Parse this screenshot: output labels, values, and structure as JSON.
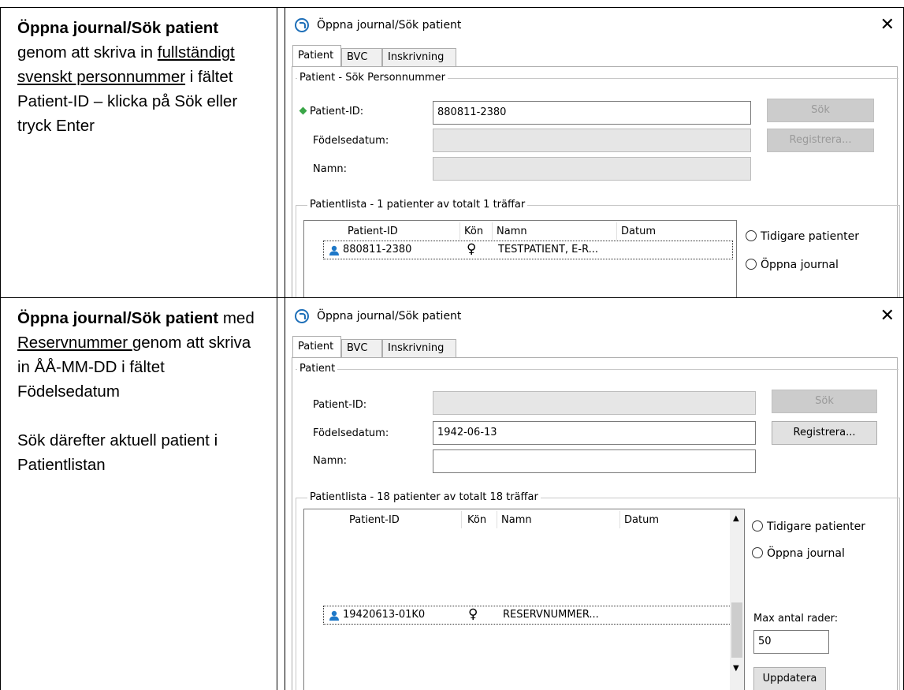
{
  "rows": [
    {
      "instruction": {
        "bold_lead": "Öppna journal/Sök patient",
        "after_bold": " genom att skriva in ",
        "underlined": "fullständigt svenskt personnummer",
        "after_underlined": " i fältet Patient-ID – klicka på Sök eller tryck Enter"
      },
      "dialog": {
        "title": "Öppna journal/Sök patient",
        "close": "✕",
        "tabs": [
          "Patient",
          "BVC",
          "Inskrivning"
        ],
        "search_group_label": "Patient - Sök Personnummer",
        "patient_id_label": "Patient-ID:",
        "patient_id_value": "880811-2380",
        "birthdate_label": "Födelsedatum:",
        "birthdate_value": "",
        "name_label": "Namn:",
        "name_value": "",
        "search_button": "Sök",
        "register_button": "Registrera...",
        "list_group_label": "Patientlista - 1 patienter av totalt 1 träffar",
        "columns": [
          "Patient-ID",
          "Kön",
          "Namn",
          "Datum"
        ],
        "list_rows": [
          {
            "id": "880811-2380",
            "sex": "♀",
            "name": "TESTPATIENT, E-R...",
            "date": ""
          }
        ],
        "radio_previous": "Tidigare patienter",
        "radio_open": "Öppna journal"
      }
    },
    {
      "instruction": {
        "bold_lead": "Öppna journal/Sök patient",
        "after_bold": " med ",
        "underlined": "Reservnummer ",
        "after_underlined": "genom att skriva in ÅÅ-MM-DD i fältet Födelsedatum",
        "second_paragraph": "Sök därefter aktuell patient i Patientlistan"
      },
      "dialog": {
        "title": "Öppna journal/Sök patient",
        "close": "✕",
        "tabs": [
          "Patient",
          "BVC",
          "Inskrivning"
        ],
        "search_group_label": "Patient",
        "patient_id_label": "Patient-ID:",
        "patient_id_value": "",
        "birthdate_label": "Födelsedatum:",
        "birthdate_value": "1942-06-13",
        "name_label": "Namn:",
        "name_value": "",
        "search_button": "Sök",
        "register_button": "Registrera...",
        "list_group_label": "Patientlista - 18 patienter av totalt 18 träffar",
        "columns": [
          "Patient-ID",
          "Kön",
          "Namn",
          "Datum"
        ],
        "list_rows": [
          {
            "id": "19420613-01K0",
            "sex": "♀",
            "name": "RESERVNUMMER...",
            "date": ""
          }
        ],
        "radio_previous": "Tidigare patienter",
        "radio_open": "Öppna journal",
        "max_rows_label": "Max antal rader:",
        "max_rows_value": "50",
        "update_button": "Uppdatera"
      }
    }
  ]
}
